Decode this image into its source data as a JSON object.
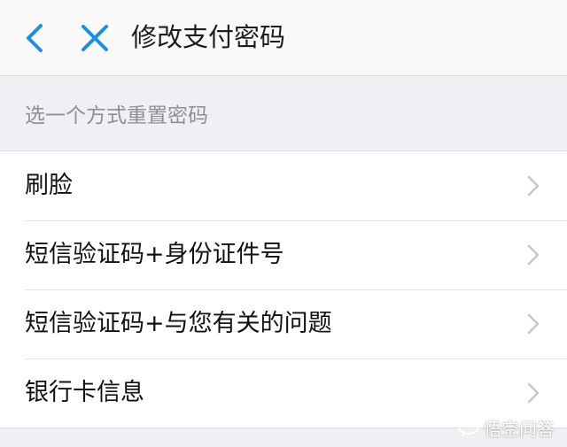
{
  "nav": {
    "title": "修改支付密码",
    "back_icon": "chevron-left-icon",
    "close_icon": "close-icon",
    "accent_color": "#1a8fe3"
  },
  "section": {
    "header": "选一个方式重置密码"
  },
  "options": [
    {
      "label": "刷脸"
    },
    {
      "label": "短信验证码+身份证件号"
    },
    {
      "label": "短信验证码+与您有关的问题"
    },
    {
      "label": "银行卡信息"
    }
  ],
  "watermark": {
    "text": "悟空问答"
  }
}
